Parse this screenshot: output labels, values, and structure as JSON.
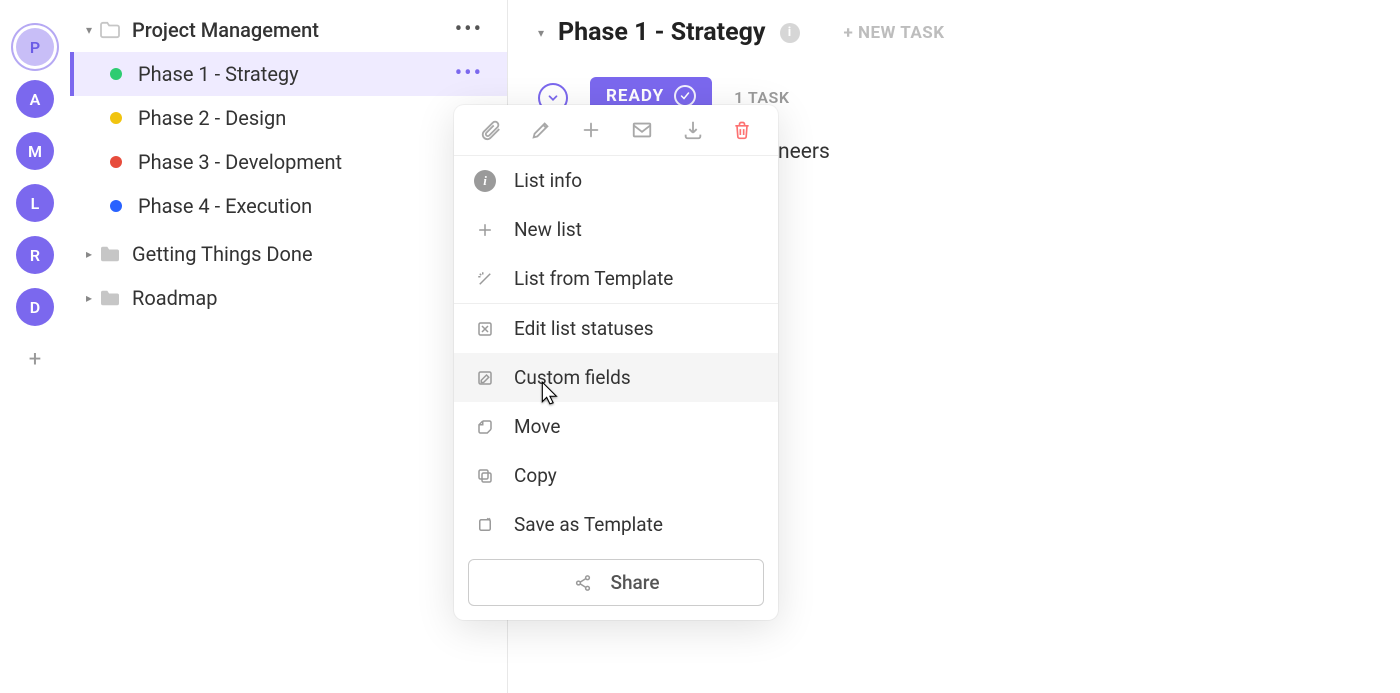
{
  "avatars": {
    "items": [
      {
        "letter": "P",
        "active": true
      },
      {
        "letter": "A",
        "active": false
      },
      {
        "letter": "M",
        "active": false
      },
      {
        "letter": "L",
        "active": false
      },
      {
        "letter": "R",
        "active": false
      },
      {
        "letter": "D",
        "active": false
      }
    ],
    "add_label": "+"
  },
  "sidebar": {
    "project": {
      "name": "Project Management"
    },
    "phases": [
      {
        "label": "Phase 1 - Strategy",
        "dot_color": "#2ecc71",
        "selected": true
      },
      {
        "label": "Phase 2 - Design",
        "dot_color": "#f1c40f",
        "selected": false
      },
      {
        "label": "Phase 3 - Development",
        "dot_color": "#e74c3c",
        "selected": false
      },
      {
        "label": "Phase 4 - Execution",
        "dot_color": "#2962ff",
        "selected": false
      }
    ],
    "folders": [
      {
        "label": "Getting Things Done"
      },
      {
        "label": "Roadmap"
      }
    ]
  },
  "main": {
    "title": "Phase 1 - Strategy",
    "new_task": "+ NEW TASK",
    "status_label": "READY",
    "task_count": "1 TASK",
    "task_fragment": "neers"
  },
  "context_menu": {
    "toolbar_icons": {
      "attach": "attach-icon",
      "edit": "pencil-icon",
      "add": "plus-icon",
      "mail": "mail-icon",
      "download": "download-icon",
      "delete": "trash-icon"
    },
    "items": [
      {
        "label": "List info",
        "icon": "info"
      },
      {
        "label": "New list",
        "icon": "plus"
      },
      {
        "label": "List from Template",
        "icon": "wand"
      },
      {
        "label": "Edit list statuses",
        "icon": "statuses"
      },
      {
        "label": "Custom fields",
        "icon": "compose",
        "hovered": true
      },
      {
        "label": "Move",
        "icon": "move"
      },
      {
        "label": "Copy",
        "icon": "copy"
      },
      {
        "label": "Save as Template",
        "icon": "template"
      }
    ],
    "share_label": "Share"
  }
}
